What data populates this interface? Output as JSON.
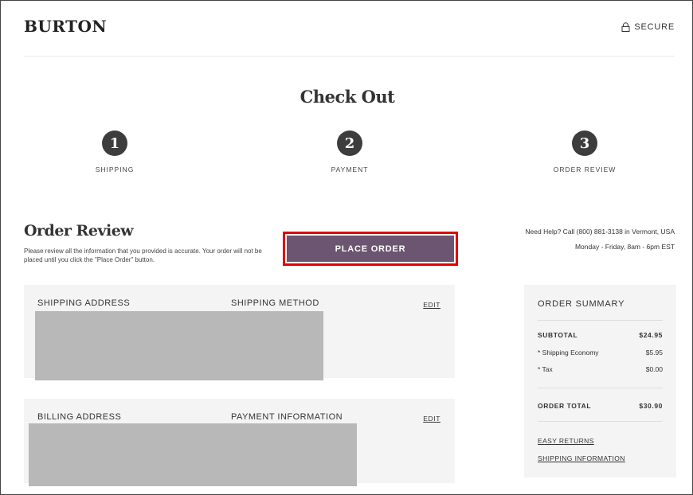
{
  "header": {
    "logo": "BURTON",
    "secure_label": "SECURE"
  },
  "checkout": {
    "title": "Check Out",
    "steps": [
      {
        "number": "1",
        "label": "SHIPPING"
      },
      {
        "number": "2",
        "label": "PAYMENT"
      },
      {
        "number": "3",
        "label": "ORDER REVIEW"
      }
    ]
  },
  "review": {
    "title": "Order Review",
    "description": "Please review all the information that you provided is accurate. Your order will not be placed until you click the \"Place Order\" button.",
    "place_order_label": "PLACE ORDER",
    "help_line1": "Need Help? Call (800) 881-3138 in Vermont, USA",
    "help_line2": "Monday - Friday, 8am - 6pm EST"
  },
  "shipping_panel": {
    "address_label": "SHIPPING ADDRESS",
    "method_label": "SHIPPING METHOD",
    "edit_label": "EDIT"
  },
  "billing_panel": {
    "address_label": "BILLING ADDRESS",
    "payment_label": "PAYMENT INFORMATION",
    "edit_label": "EDIT"
  },
  "summary": {
    "title": "ORDER SUMMARY",
    "subtotal_label": "SUBTOTAL",
    "subtotal_value": "$24.95",
    "shipping_label": "* Shipping Economy",
    "shipping_value": "$5.95",
    "tax_label": "* Tax",
    "tax_value": "$0.00",
    "total_label": "ORDER TOTAL",
    "total_value": "$30.90",
    "easy_returns": "EASY RETURNS",
    "shipping_info": "SHIPPING INFORMATION"
  },
  "colors": {
    "place_order_bg": "#6b5570",
    "highlight_border": "#e00000",
    "step_circle": "#3d3d3d",
    "panel_bg": "#f4f4f4",
    "redaction": "#b8b8b8"
  },
  "icons": {
    "secure": "lock-icon"
  }
}
